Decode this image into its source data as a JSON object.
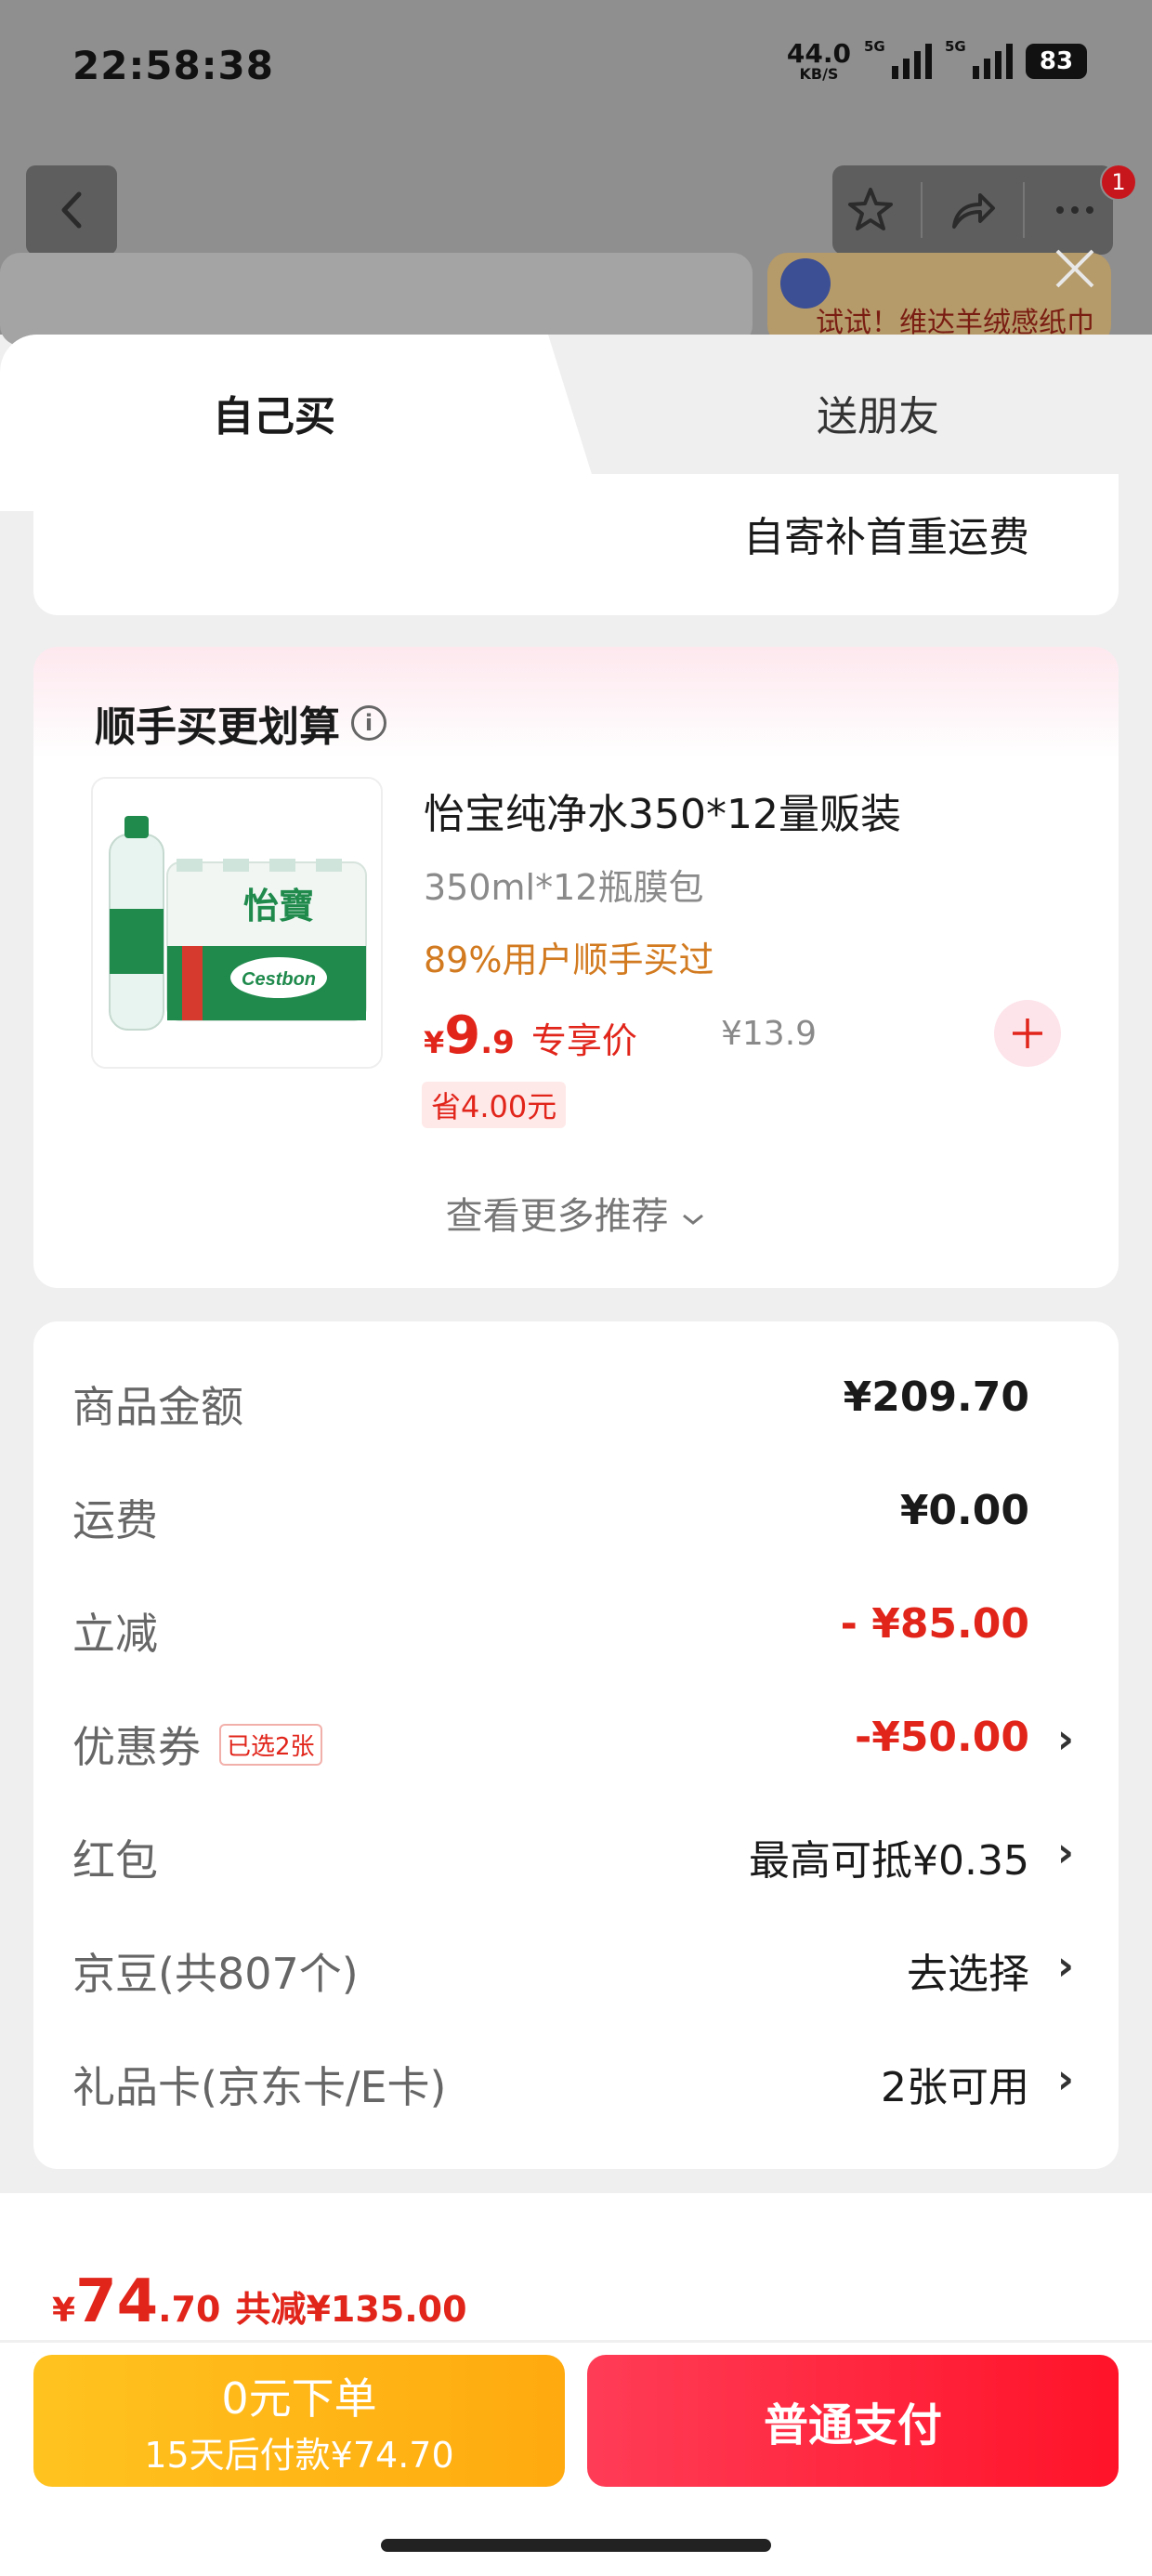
{
  "status_bar": {
    "time": "22:58:38",
    "net_speed_value": "44.0",
    "net_speed_unit": "KB/S",
    "signal1_label": "5G",
    "signal2_label": "5G",
    "battery": "83"
  },
  "background": {
    "nav_badge": "1",
    "ad_text": "试试！维达羊绒感纸巾"
  },
  "tabs": {
    "self_label": "自己买",
    "gift_label": "送朋友"
  },
  "shipping": {
    "text": "自寄补首重运费"
  },
  "recommend": {
    "title": "顺手买更划算",
    "product_name": "怡宝纯净水350*12量贩装",
    "spec": "350ml*12瓶膜包",
    "bought": "89%用户顺手买过",
    "price_currency": "¥",
    "price_int": "9",
    "price_dec": ".9",
    "price_tag": "专享价",
    "original_price": "¥13.9",
    "save": "省4.00元",
    "more": "查看更多推荐",
    "image_brand": "怡寶",
    "image_sub": "Cestbon"
  },
  "summary": {
    "rows": [
      {
        "label": "商品金额",
        "value": "¥209.70"
      },
      {
        "label": "运费",
        "value": "¥0.00"
      },
      {
        "label": "立减",
        "value": "- ¥85.00"
      },
      {
        "label": "优惠券",
        "badge": "已选2张",
        "value": "-¥50.00"
      },
      {
        "label": "红包",
        "value": "最高可抵¥0.35"
      },
      {
        "label": "京豆(共807个)",
        "value": "去选择"
      },
      {
        "label": "礼品卡(京东卡/E卡)",
        "value": "2张可用"
      }
    ]
  },
  "footer": {
    "total_currency": "¥",
    "total_int": "74",
    "total_dec": ".70",
    "total_cut": "共减¥135.00",
    "zero_title": "0元下单",
    "zero_sub": "15天后付款¥74.70",
    "pay_label": "普通支付"
  },
  "colors": {
    "accent_red": "#e1251b",
    "pay_button": "#ff1329",
    "zero_button": "#ffaa0f",
    "bought_orange": "#d27a1f"
  },
  "icons": [
    "back-arrow-icon",
    "star-icon",
    "share-icon",
    "more-icon",
    "close-icon",
    "info-icon",
    "plus-icon",
    "chevron-down-icon",
    "chevron-right-icon"
  ]
}
